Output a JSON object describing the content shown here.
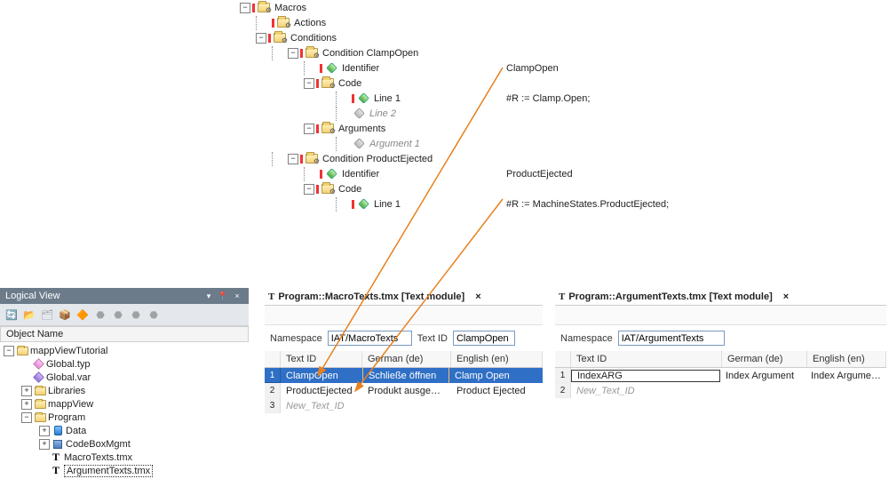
{
  "tree": {
    "root": "Macros",
    "actions": "Actions",
    "conditions": "Conditions",
    "cond1": {
      "name": "Condition ClampOpen",
      "identifier_label": "Identifier",
      "identifier_value": "ClampOpen",
      "code_label": "Code",
      "line1_label": "Line 1",
      "line1_value": "#R := Clamp.Open;",
      "line2_label": "Line 2",
      "args_label": "Arguments",
      "arg1_label": "Argument 1"
    },
    "cond2": {
      "name": "Condition ProductEjected",
      "identifier_label": "Identifier",
      "identifier_value": "ProductEjected",
      "code_label": "Code",
      "line1_label": "Line 1",
      "line1_value": "#R := MachineStates.ProductEjected;"
    }
  },
  "logical": {
    "title": "Logical View",
    "header": "Object Name",
    "root": "mappViewTutorial",
    "items": [
      "Global.typ",
      "Global.var",
      "Libraries",
      "mappView"
    ],
    "program": "Program",
    "program_children": [
      "Data",
      "CodeBoxMgmt",
      "MacroTexts.tmx",
      "ArgumentTexts.tmx"
    ]
  },
  "editor1": {
    "tab": "Program::MacroTexts.tmx [Text module]",
    "ns_label": "Namespace",
    "ns_value": "IAT/MacroTexts",
    "textid_label": "Text ID",
    "textid_value": "ClampOpen",
    "cols": [
      "Text ID",
      "German (de)",
      "English (en)"
    ],
    "rows": [
      {
        "id": "ClampOpen",
        "de": "Schließe öffnen",
        "en": "Clamp Open"
      },
      {
        "id": "ProductEjected",
        "de": "Produkt ausgewor...",
        "en": "Product Ejected"
      }
    ],
    "ghost": "New_Text_ID"
  },
  "editor2": {
    "tab": "Program::ArgumentTexts.tmx [Text module]",
    "ns_label": "Namespace",
    "ns_value": "IAT/ArgumentTexts",
    "cols": [
      "Text ID",
      "German (de)",
      "English (en)"
    ],
    "rows": [
      {
        "id": "IndexARG",
        "de": "Index Argument",
        "en": "Index Arguments"
      }
    ],
    "ghost": "New_Text_ID"
  },
  "glyph": {
    "minus": "−",
    "plus": "+",
    "close": "×",
    "pin": "📌",
    "down": "▾"
  }
}
